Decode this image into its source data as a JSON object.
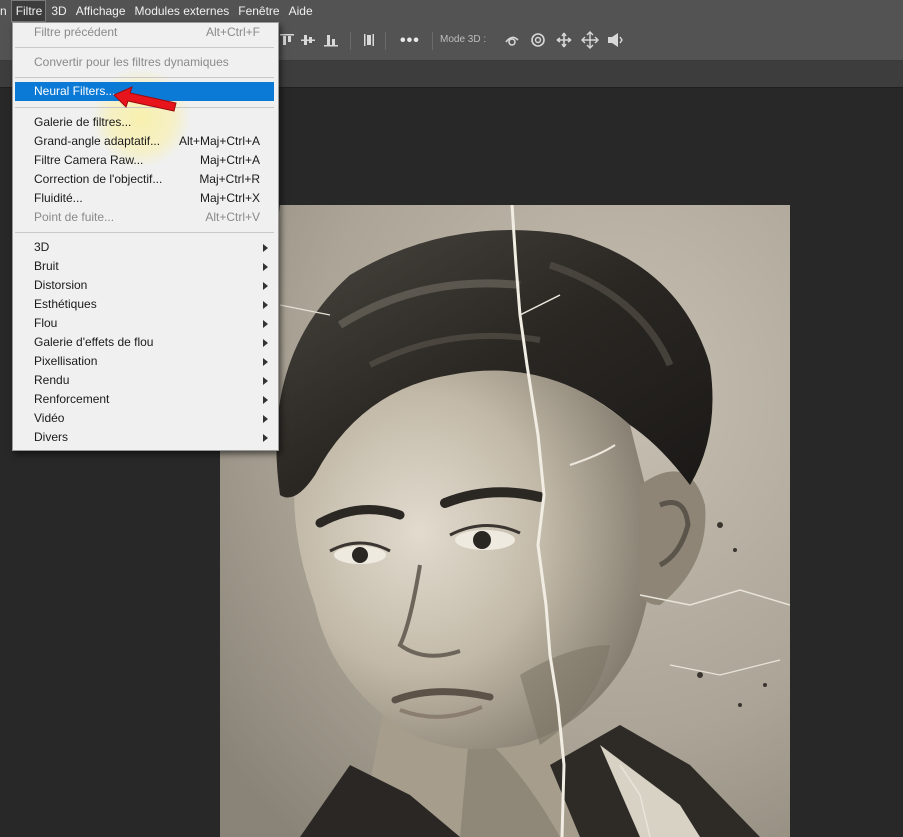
{
  "menubar": {
    "items": [
      {
        "label": "n"
      },
      {
        "label": "Filtre"
      },
      {
        "label": "3D"
      },
      {
        "label": "Affichage"
      },
      {
        "label": "Modules externes"
      },
      {
        "label": "Fenêtre"
      },
      {
        "label": "Aide"
      }
    ]
  },
  "optionsbar": {
    "more_label": "•••",
    "mode3d_label": "Mode 3D :"
  },
  "filter_menu": {
    "items": [
      {
        "label": "Filtre précédent",
        "shortcut": "Alt+Ctrl+F"
      },
      {
        "label": "Convertir pour les filtres dynamiques",
        "shortcut": ""
      },
      {
        "label": "Neural Filters...",
        "shortcut": ""
      },
      {
        "label": "Galerie de filtres...",
        "shortcut": ""
      },
      {
        "label": "Grand-angle adaptatif...",
        "shortcut": "Alt+Maj+Ctrl+A"
      },
      {
        "label": "Filtre Camera Raw...",
        "shortcut": "Maj+Ctrl+A"
      },
      {
        "label": "Correction de l'objectif...",
        "shortcut": "Maj+Ctrl+R"
      },
      {
        "label": "Fluidité...",
        "shortcut": "Maj+Ctrl+X"
      },
      {
        "label": "Point de fuite...",
        "shortcut": "Alt+Ctrl+V"
      },
      {
        "label": "3D"
      },
      {
        "label": "Bruit"
      },
      {
        "label": "Distorsion"
      },
      {
        "label": "Esthétiques"
      },
      {
        "label": "Flou"
      },
      {
        "label": "Galerie d'effets de flou"
      },
      {
        "label": "Pixellisation"
      },
      {
        "label": "Rendu"
      },
      {
        "label": "Renforcement"
      },
      {
        "label": "Vidéo"
      },
      {
        "label": "Divers"
      }
    ]
  },
  "colors": {
    "highlight": "#0a7ad6",
    "pointer": "#e8141b",
    "menubar": "#535353",
    "canvas": "#282828"
  }
}
